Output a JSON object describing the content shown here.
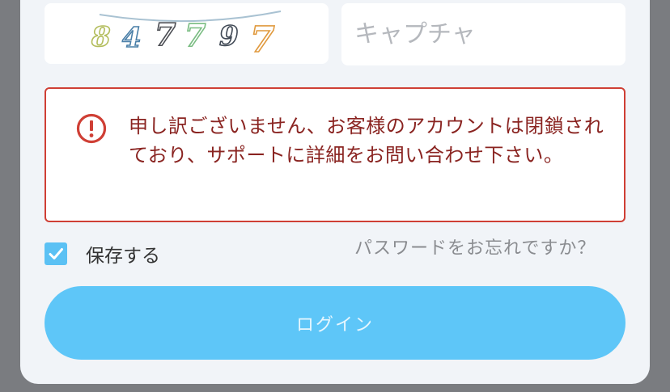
{
  "captcha": {
    "digits": [
      "8",
      "4",
      "7",
      "7",
      "9",
      "7"
    ],
    "placeholder": "キャプチャ",
    "value": ""
  },
  "error": {
    "message": "申し訳ございません、お客様のアカウントは閉鎖されており、サポートに詳細をお問い合わせ下さい。",
    "color": "#cf3f35"
  },
  "remember": {
    "label": "保存する",
    "checked": true
  },
  "forgot_password": {
    "label": "パスワードをお忘れですか？"
  },
  "login": {
    "label": "ログイン"
  },
  "colors": {
    "accent": "#5ec6f8",
    "error": "#cf3f35",
    "background": "#f1f4f8"
  }
}
